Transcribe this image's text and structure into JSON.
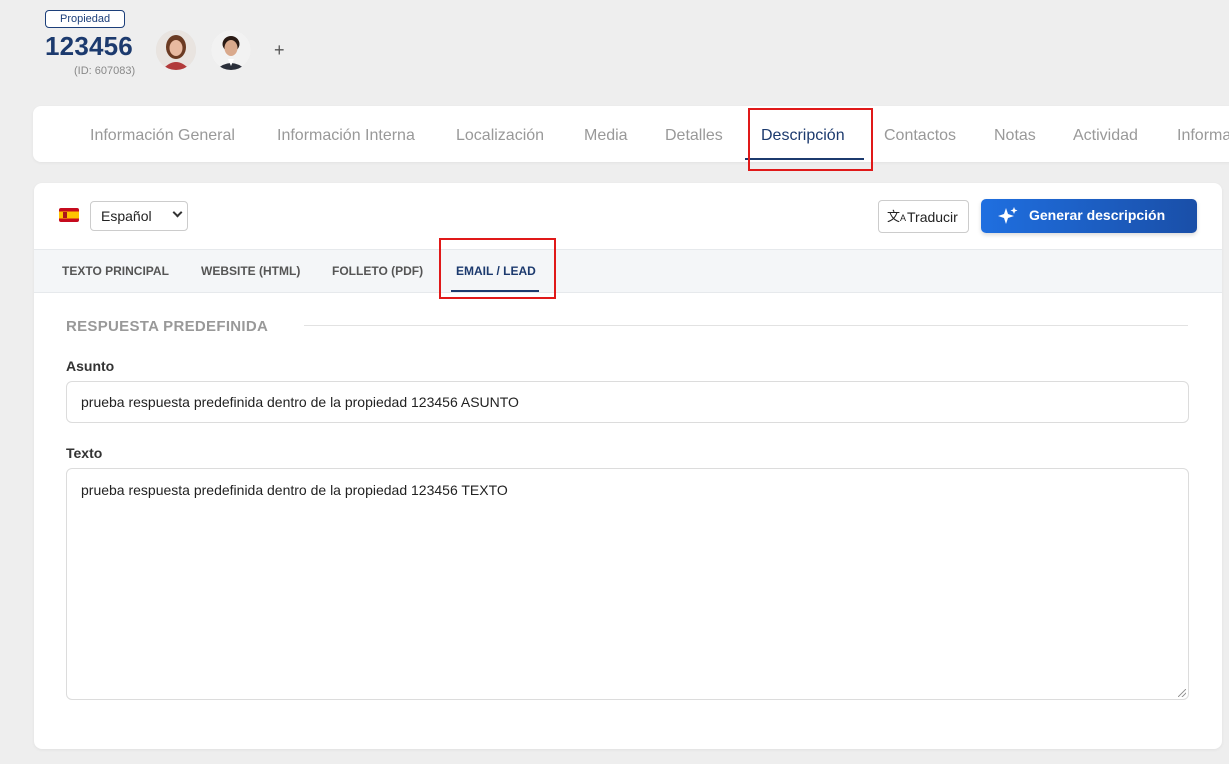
{
  "header": {
    "badge": "Propiedad",
    "reference": "123456",
    "id_label": "(ID: 607083)",
    "add_label": "+"
  },
  "nav_tabs": [
    {
      "label": "Información General"
    },
    {
      "label": "Información Interna"
    },
    {
      "label": "Localización"
    },
    {
      "label": "Media"
    },
    {
      "label": "Detalles"
    },
    {
      "label": "Descripción",
      "active": true
    },
    {
      "label": "Contactos"
    },
    {
      "label": "Notas"
    },
    {
      "label": "Actividad"
    },
    {
      "label": "Informa"
    }
  ],
  "language": {
    "selected": "Español",
    "flag": "spain-flag-icon"
  },
  "actions": {
    "translate_label": "Traducir",
    "translate_icon": "translate-icon",
    "generate_label": "Generar descripción",
    "generate_icon": "sparkle-icon"
  },
  "sub_tabs": [
    {
      "label": "TEXTO PRINCIPAL"
    },
    {
      "label": "WEBSITE (HTML)"
    },
    {
      "label": "FOLLETO (PDF)"
    },
    {
      "label": "EMAIL / LEAD",
      "active": true
    }
  ],
  "form": {
    "section_title": "RESPUESTA PREDEFINIDA",
    "subject_label": "Asunto",
    "subject_value": "prueba respuesta predefinida dentro de la propiedad 123456 ASUNTO",
    "text_label": "Texto",
    "text_value": "prueba respuesta predefinida dentro de la propiedad 123456 TEXTO"
  },
  "colors": {
    "primary": "#1c3a6e",
    "button_blue": "#1f6fe0",
    "highlight_red": "#e01919",
    "background": "#eeeeee"
  }
}
